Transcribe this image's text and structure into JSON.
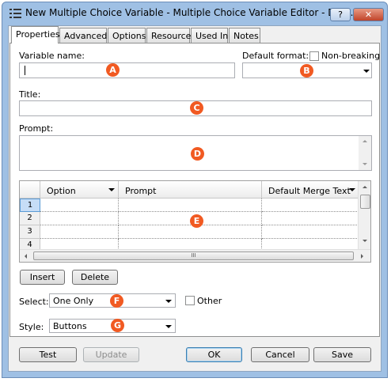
{
  "window": {
    "title": "New Multiple Choice Variable - Multiple Choice Variable Editor - Dem...",
    "help_label": "?",
    "close_label": "✕"
  },
  "tabs": [
    {
      "label": "Properties",
      "active": true
    },
    {
      "label": "Advanced",
      "active": false
    },
    {
      "label": "Options",
      "active": false
    },
    {
      "label": "Resource",
      "active": false
    },
    {
      "label": "Used In",
      "active": false
    },
    {
      "label": "Notes",
      "active": false
    }
  ],
  "form": {
    "variable_name_label": "Variable name:",
    "variable_name_value": "",
    "default_format_label": "Default format:",
    "non_breaking_label": "Non-breaking",
    "non_breaking_checked": false,
    "default_format_value": "",
    "title_label": "Title:",
    "title_value": "",
    "prompt_label": "Prompt:",
    "prompt_value": ""
  },
  "grid": {
    "columns": [
      "Option",
      "Prompt",
      "Default Merge Text"
    ],
    "rows": [
      "1",
      "2",
      "3",
      "4"
    ],
    "scroll_grip": "III"
  },
  "grid_buttons": {
    "insert": "Insert",
    "delete": "Delete"
  },
  "select": {
    "label": "Select:",
    "value": "One Only",
    "other_label": "Other",
    "other_checked": false
  },
  "style": {
    "label": "Style:",
    "value": "Buttons"
  },
  "badges": [
    "A",
    "B",
    "C",
    "D",
    "E",
    "F",
    "G"
  ],
  "footer": {
    "test": "Test",
    "update": "Update",
    "ok": "OK",
    "cancel": "Cancel",
    "save": "Save"
  },
  "colors": {
    "badge": "#f15a22",
    "titlebar": "#9fc0e4",
    "close": "#c0442a",
    "row_selected": "#c6ddf6"
  }
}
